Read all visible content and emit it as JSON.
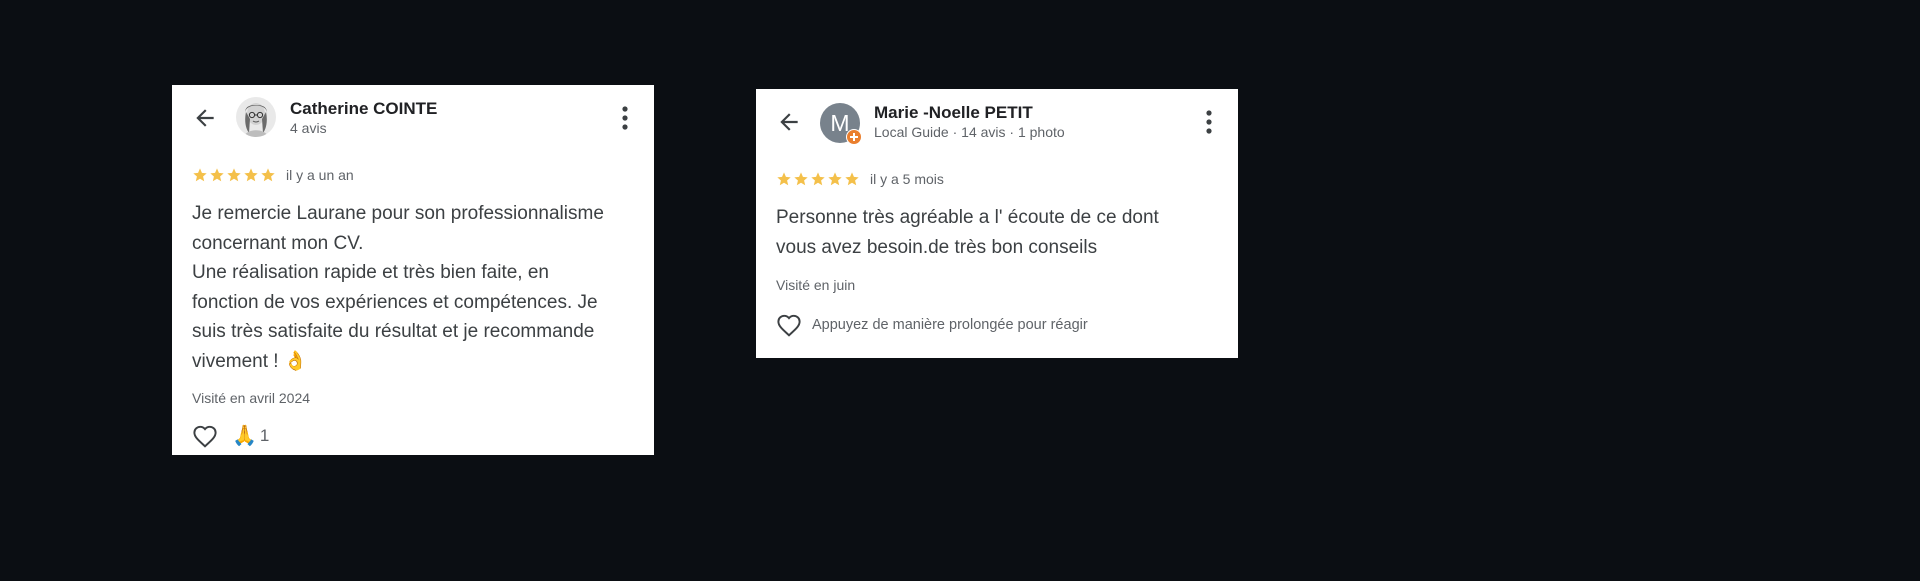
{
  "reviews": [
    {
      "reviewer_name": "Catherine COINTE",
      "reviewer_meta": "4 avis",
      "rating": 5,
      "date": "il y a un an",
      "text": "Je remercie Laurane pour son professionnalisme\nconcernant mon CV.\nUne réalisation rapide et très bien faite, en\nfonction de vos expériences et compétences. Je\nsuis très satisfaite du résultat et je recommande\nvivement ! 👌",
      "visited": "Visité en avril 2024",
      "reaction_emoji": "🙏",
      "reaction_count": "1"
    },
    {
      "reviewer_name": "Marie -Noelle PETIT",
      "reviewer_meta": "Local Guide · 14 avis · 1 photo",
      "avatar_letter": "M",
      "rating": 5,
      "date": "il y a 5 mois",
      "text": "Personne très agréable a l' écoute de ce dont\nvous avez besoin.de très bon conseils",
      "visited": "Visité en juin",
      "react_hint": "Appuyez de manière prolongée pour réagir"
    }
  ],
  "icons": {
    "back": "arrow-left-icon",
    "menu": "more-vert-icon",
    "star": "star-icon",
    "heart": "heart-outline-icon",
    "local_guide": "local-guide-badge-icon"
  },
  "colors": {
    "background": "#0b0e13",
    "card": "#ffffff",
    "star": "#f4c04a",
    "name": "#202124",
    "text": "#3c4043",
    "muted": "#5f6368",
    "avatar_m": "#78828c",
    "local_guide_badge": "#ea7f2e"
  }
}
